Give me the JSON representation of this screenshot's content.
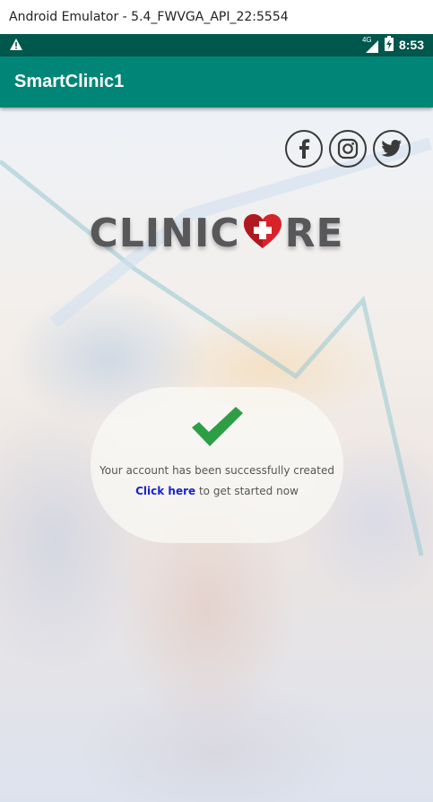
{
  "window": {
    "title": "Android Emulator - 5.4_FWVGA_API_22:5554"
  },
  "status_bar": {
    "time": "8:53",
    "network_label": "4G"
  },
  "app_bar": {
    "title": "SmartClinic1"
  },
  "social": {
    "items": [
      "facebook-icon",
      "instagram-icon",
      "twitter-icon"
    ]
  },
  "logo": {
    "text_left": "CLINIC",
    "text_right": "RE"
  },
  "message": {
    "text": "Your account has been successfully created",
    "link_text": "Click here",
    "suffix": " to get started now"
  },
  "colors": {
    "status_bar": "#00574b",
    "app_bar": "#008577",
    "check": "#2e9e45",
    "link": "#1a22c9",
    "heart": "#d8232a"
  }
}
